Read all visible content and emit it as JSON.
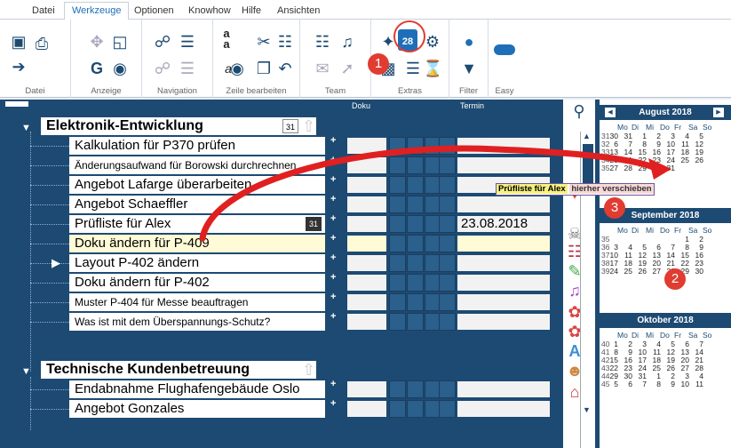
{
  "menu": [
    "Datei",
    "Werkzeuge",
    "Optionen",
    "Knowhow",
    "Hilfe",
    "Ansichten"
  ],
  "ribbon_groups": [
    "Datei",
    "Anzeige",
    "Navigation",
    "Zeile bearbeiten",
    "Team",
    "Extras",
    "Filter",
    "Easy"
  ],
  "extras_date_icon": "28",
  "columns": {
    "doku": "Doku",
    "termin": "Termin"
  },
  "categories": [
    {
      "label": "Elektronik-Entwicklung",
      "cal_icon": "31"
    },
    {
      "label": "Technische Kundenbetreuung"
    }
  ],
  "tasks": [
    {
      "label": "Kalkulation für P370 prüfen"
    },
    {
      "label": "Änderungsaufwand für Borowski durchrechnen"
    },
    {
      "label": "Angebot Lafarge überarbeiten"
    },
    {
      "label": "Angebot Schaeffler"
    },
    {
      "label": "Prüfliste für Alex",
      "cal_icon": "31",
      "date": "23.08.2018"
    },
    {
      "label": "Doku ändern für P-409"
    },
    {
      "label": "Layout P-402 ändern"
    },
    {
      "label": "Doku ändern für P-402"
    },
    {
      "label": "Muster P-404 für Messe beauftragen"
    },
    {
      "label": "Was ist mit dem Überspannungs-Schutz?"
    },
    {
      "label": "Endabnahme Flughafengebäude Oslo"
    },
    {
      "label": "Angebot Gonzales"
    }
  ],
  "calendar": {
    "weekdays": [
      "Mo",
      "Di",
      "Mi",
      "Do",
      "Fr",
      "Sa",
      "So"
    ],
    "months": [
      {
        "title": "August 2018",
        "weeks": [
          [
            "31",
            "30",
            "31",
            "1",
            "2",
            "3",
            "4",
            "5"
          ],
          [
            "32",
            "6",
            "7",
            "8",
            "9",
            "10",
            "11",
            "12"
          ],
          [
            "33",
            "13",
            "14",
            "15",
            "16",
            "17",
            "18",
            "19"
          ],
          [
            "34",
            "20",
            "21",
            "22",
            "23",
            "24",
            "25",
            "26"
          ],
          [
            "35",
            "27",
            "28",
            "29",
            "30",
            "31",
            "",
            ""
          ]
        ]
      },
      {
        "title": "September 2018",
        "weeks": [
          [
            "35",
            "",
            "",
            "",
            "",
            "",
            "1",
            "2"
          ],
          [
            "36",
            "3",
            "4",
            "5",
            "6",
            "7",
            "8",
            "9"
          ],
          [
            "37",
            "10",
            "11",
            "12",
            "13",
            "14",
            "15",
            "16"
          ],
          [
            "38",
            "17",
            "18",
            "19",
            "20",
            "21",
            "22",
            "23"
          ],
          [
            "39",
            "24",
            "25",
            "26",
            "27",
            "28",
            "29",
            "30"
          ]
        ]
      },
      {
        "title": "Oktober 2018",
        "weeks": [
          [
            "40",
            "1",
            "2",
            "3",
            "4",
            "5",
            "6",
            "7"
          ],
          [
            "41",
            "8",
            "9",
            "10",
            "11",
            "12",
            "13",
            "14"
          ],
          [
            "42",
            "15",
            "16",
            "17",
            "18",
            "19",
            "20",
            "21"
          ],
          [
            "43",
            "22",
            "23",
            "24",
            "25",
            "26",
            "27",
            "28"
          ],
          [
            "44",
            "29",
            "30",
            "31",
            "1",
            "2",
            "3",
            "4"
          ],
          [
            "45",
            "5",
            "6",
            "7",
            "8",
            "9",
            "10",
            "11"
          ]
        ]
      }
    ]
  },
  "tooltip": {
    "part1": "Prüfliste für Alex",
    "part2": "hierher verschieben"
  },
  "badges": [
    "1",
    "2",
    "3"
  ],
  "colors": {
    "accent": "#1d4a72",
    "callout": "#e03c31"
  }
}
